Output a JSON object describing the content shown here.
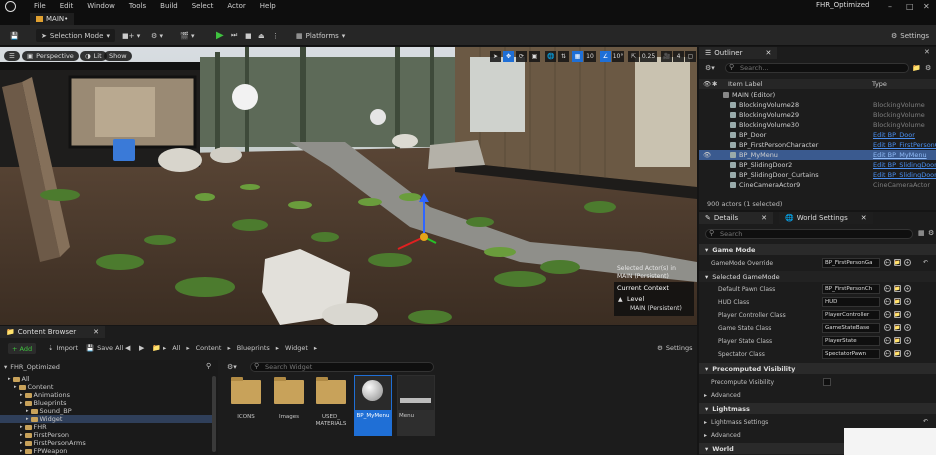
{
  "menubar": {
    "items": [
      "File",
      "Edit",
      "Window",
      "Tools",
      "Build",
      "Select",
      "Actor",
      "Help"
    ],
    "project_name": "FHR_Optimized"
  },
  "level_tab": {
    "label": "MAIN•"
  },
  "toolbar": {
    "selection_mode": "Selection Mode",
    "platforms": "Platforms",
    "settings": "Settings"
  },
  "viewport": {
    "perspective": "Perspective",
    "lit": "Lit",
    "show": "Show",
    "grid_snap": "10",
    "rot_snap": "10°",
    "scale_snap": "0.25",
    "cam_speed": "4",
    "selected_actors": "Selected Actor(s) in",
    "selected_level": "MAIN (Persistent)",
    "current_context": "Current Context",
    "level_label": "Level",
    "level_value": "MAIN (Persistent)"
  },
  "outliner": {
    "tab": "Outliner",
    "search_placeholder": "Search...",
    "col_label": "Item Label",
    "col_type": "Type",
    "rows": [
      {
        "label": "MAIN (Editor)",
        "type": "",
        "link": false,
        "selected": false
      },
      {
        "label": "BlockingVolume28",
        "type": "BlockingVolume",
        "link": false,
        "selected": false
      },
      {
        "label": "BlockingVolume29",
        "type": "BlockingVolume",
        "link": false,
        "selected": false
      },
      {
        "label": "BlockingVolume30",
        "type": "BlockingVolume",
        "link": false,
        "selected": false
      },
      {
        "label": "BP_Door",
        "type": "Edit BP_Door",
        "link": true,
        "selected": false
      },
      {
        "label": "BP_FirstPersonCharacter",
        "type": "Edit BP_FirstPersonC",
        "link": true,
        "selected": false
      },
      {
        "label": "BP_MyMenu",
        "type": "Edit BP_MyMenu",
        "link": true,
        "selected": true
      },
      {
        "label": "BP_SlidingDoor2",
        "type": "Edit BP_SlidingDoor",
        "link": true,
        "selected": false
      },
      {
        "label": "BP_SlidingDoor_Curtains",
        "type": "Edit BP_SlidingDoor",
        "link": true,
        "selected": false
      },
      {
        "label": "CineCameraActor9",
        "type": "CineCameraActor",
        "link": false,
        "selected": false
      }
    ],
    "status": "900 actors (1 selected)"
  },
  "details": {
    "tab_details": "Details",
    "tab_world": "World Settings",
    "search_placeholder": "Search",
    "sec_game_mode": "Game Mode",
    "gamemode_override_label": "GameMode Override",
    "gamemode_override_value": "BP_FirstPersonGa",
    "sec_selected_gamemode": "Selected GameMode",
    "props": [
      {
        "label": "Default Pawn Class",
        "value": "BP_FirstPersonCh"
      },
      {
        "label": "HUD Class",
        "value": "HUD"
      },
      {
        "label": "Player Controller Class",
        "value": "PlayerController"
      },
      {
        "label": "Game State Class",
        "value": "GameStateBase"
      },
      {
        "label": "Player State Class",
        "value": "PlayerState"
      },
      {
        "label": "Spectator Class",
        "value": "SpectatorPawn"
      }
    ],
    "sec_precomputed": "Precomputed Visibility",
    "precompute_label": "Precompute Visibility",
    "advanced_1": "Advanced",
    "sec_lightmass": "Lightmass",
    "lightmass_settings": "Lightmass Settings",
    "advanced_2": "Advanced",
    "sec_world": "World"
  },
  "content_browser": {
    "tab": "Content Browser",
    "add": "+ Add",
    "import": "Import",
    "save_all": "Save All",
    "crumbs": [
      "All",
      "Content",
      "Blueprints",
      "Widget"
    ],
    "settings": "Settings",
    "tree_root": "FHR_Optimized",
    "search_placeholder": "Search Widget",
    "tree": [
      {
        "label": "All",
        "indent": 0,
        "selected": false
      },
      {
        "label": "Content",
        "indent": 1,
        "selected": false
      },
      {
        "label": "Animations",
        "indent": 2,
        "selected": false
      },
      {
        "label": "Blueprints",
        "indent": 2,
        "selected": false
      },
      {
        "label": "Sound_BP",
        "indent": 3,
        "selected": false
      },
      {
        "label": "Widget",
        "indent": 3,
        "selected": true
      },
      {
        "label": "FHR",
        "indent": 2,
        "selected": false
      },
      {
        "label": "FirstPerson",
        "indent": 2,
        "selected": false
      },
      {
        "label": "FirstPersonArms",
        "indent": 2,
        "selected": false
      },
      {
        "label": "FPWeapon",
        "indent": 2,
        "selected": false
      }
    ],
    "assets": [
      {
        "label": "ICONS",
        "kind": "folder"
      },
      {
        "label": "Images",
        "kind": "folder"
      },
      {
        "label": "USED_ MATERIALS",
        "kind": "folder"
      },
      {
        "label": "BP_MyMenu",
        "kind": "blueprint"
      },
      {
        "label": "Menu",
        "kind": "widget"
      }
    ]
  },
  "colors": {
    "accent": "#1f6fd6",
    "selection": "#3a5a8f",
    "link": "#4a8ff0",
    "folder": "#c8a25a",
    "play": "#3fc33f"
  }
}
